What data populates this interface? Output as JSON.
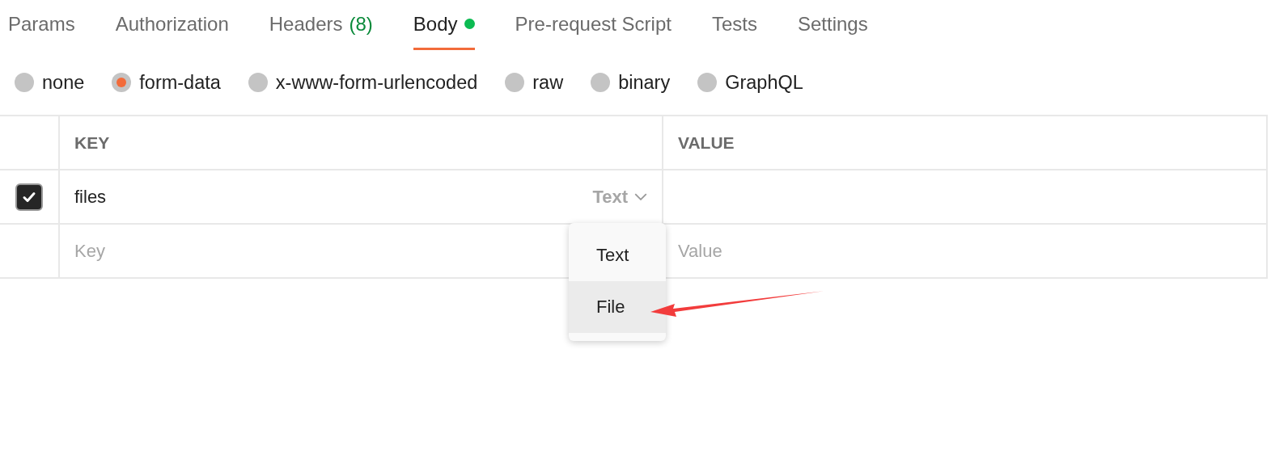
{
  "tabs": [
    {
      "label": "Params",
      "selected": false
    },
    {
      "label": "Authorization",
      "selected": false
    },
    {
      "label": "Headers",
      "count": "(8)",
      "selected": false
    },
    {
      "label": "Body",
      "has_content": true,
      "selected": true
    },
    {
      "label": "Pre-request Script",
      "selected": false
    },
    {
      "label": "Tests",
      "selected": false
    },
    {
      "label": "Settings",
      "selected": false
    }
  ],
  "body_types": [
    {
      "label": "none",
      "selected": false
    },
    {
      "label": "form-data",
      "selected": true
    },
    {
      "label": "x-www-form-urlencoded",
      "selected": false
    },
    {
      "label": "raw",
      "selected": false
    },
    {
      "label": "binary",
      "selected": false
    },
    {
      "label": "GraphQL",
      "selected": false
    }
  ],
  "table": {
    "columns": [
      "KEY",
      "VALUE"
    ],
    "rows": [
      {
        "checked": true,
        "key": "files",
        "type": "Text",
        "value": ""
      }
    ],
    "new_row": {
      "key_placeholder": "Key",
      "value_placeholder": "Value"
    }
  },
  "type_menu": {
    "items": [
      {
        "label": "Text",
        "selected": false
      },
      {
        "label": "File",
        "selected": true
      }
    ]
  }
}
